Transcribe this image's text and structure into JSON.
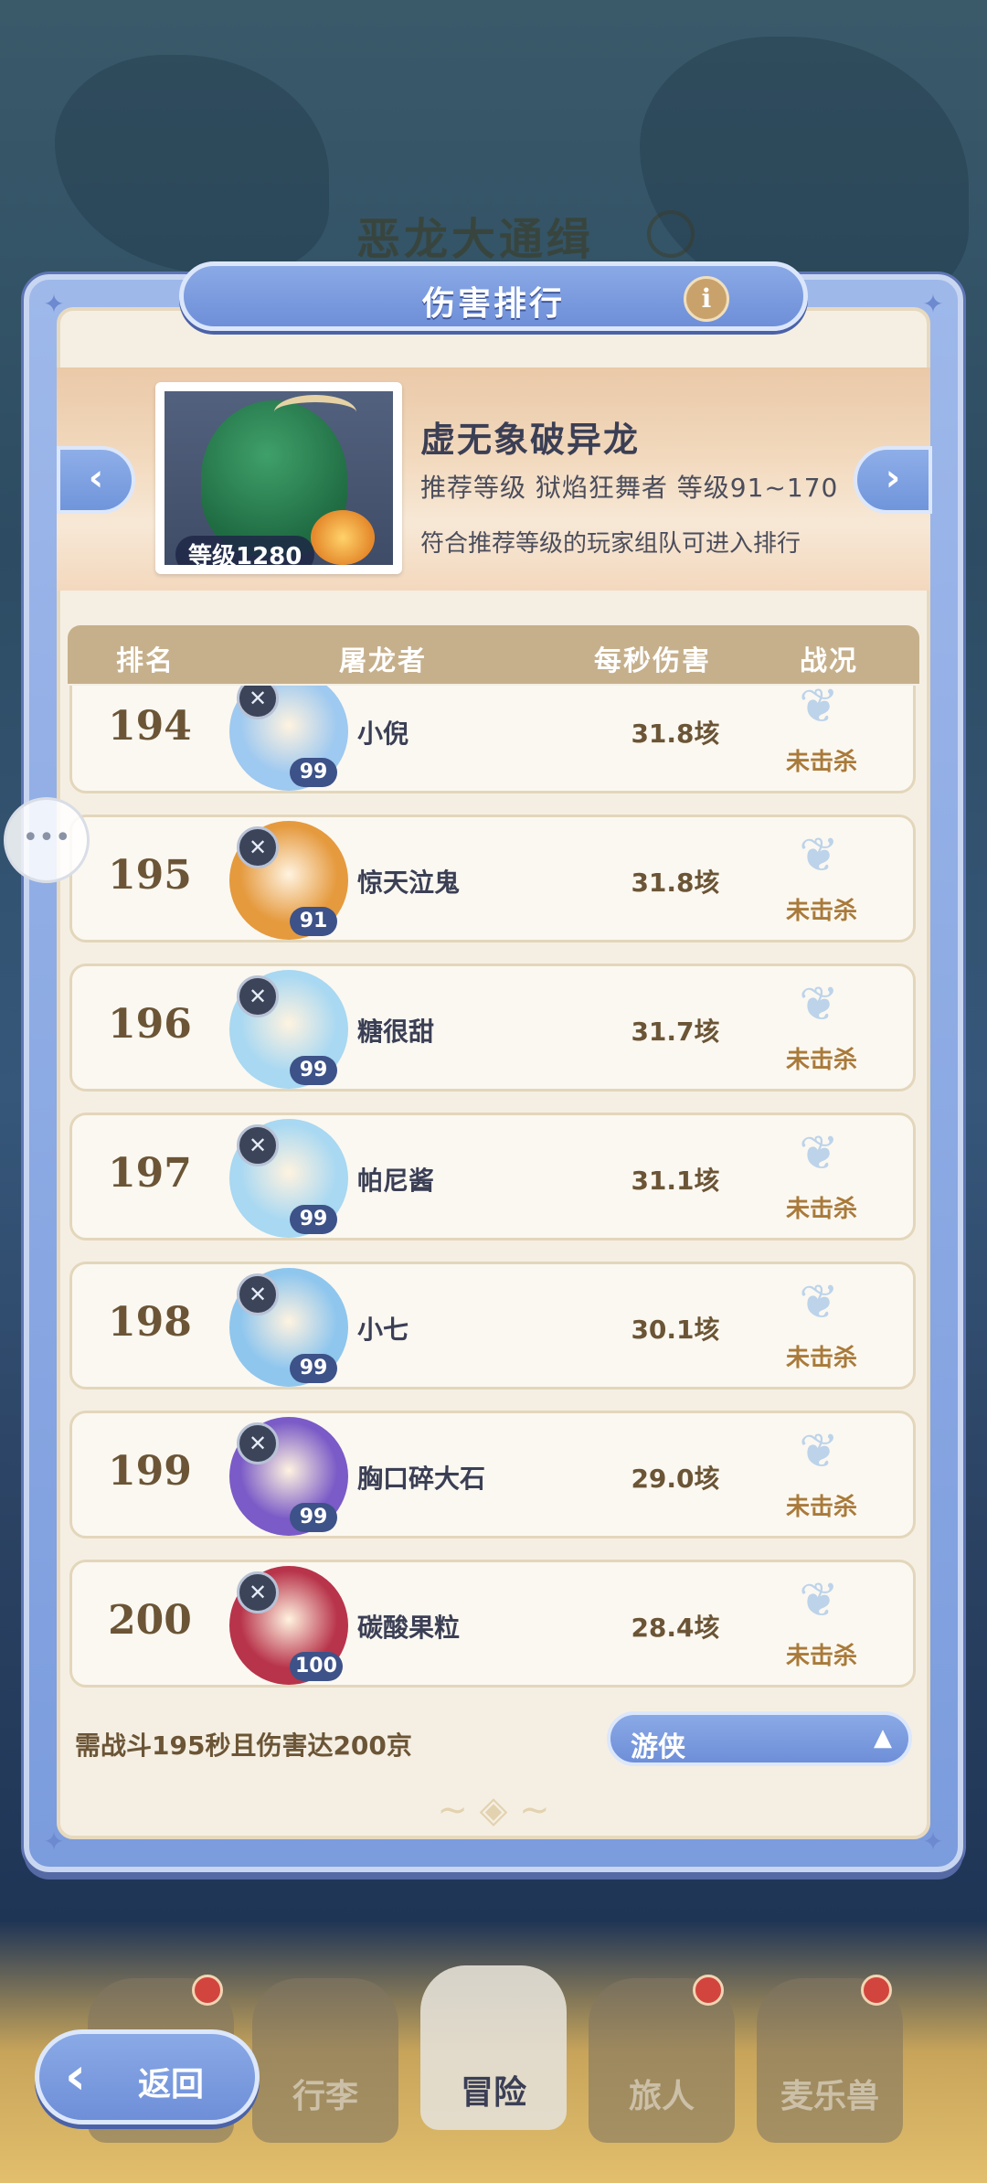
{
  "background": {
    "title": "恶龙大通缉"
  },
  "modal": {
    "title": "伤害排行",
    "info_icon": "i"
  },
  "boss": {
    "name": "虚无象破异龙",
    "level_badge": "等级1280",
    "recommendation": "推荐等级 狱焰狂舞者 等级91~170",
    "note": "符合推荐等级的玩家组队可进入排行"
  },
  "table": {
    "headers": {
      "rank": "排名",
      "player": "屠龙者",
      "dps": "每秒伤害",
      "status": "战况"
    },
    "rows": [
      {
        "rank": "194",
        "name": "小倪",
        "level": "99",
        "dps": "31.8垓",
        "status": "未击杀",
        "art_color": "#9ec9f0"
      },
      {
        "rank": "195",
        "name": "惊天泣鬼",
        "level": "91",
        "dps": "31.8垓",
        "status": "未击杀",
        "art_color": "#e59a3e"
      },
      {
        "rank": "196",
        "name": "糖很甜",
        "level": "99",
        "dps": "31.7垓",
        "status": "未击杀",
        "art_color": "#a8d8f2"
      },
      {
        "rank": "197",
        "name": "帕尼酱",
        "level": "99",
        "dps": "31.1垓",
        "status": "未击杀",
        "art_color": "#a8d8f2"
      },
      {
        "rank": "198",
        "name": "小七",
        "level": "99",
        "dps": "30.1垓",
        "status": "未击杀",
        "art_color": "#8ec6ee"
      },
      {
        "rank": "199",
        "name": "胸口碎大石",
        "level": "99",
        "dps": "29.0垓",
        "status": "未击杀",
        "art_color": "#7a5bc7"
      },
      {
        "rank": "200",
        "name": "碳酸果粒",
        "level": "100",
        "dps": "28.4垓",
        "status": "未击杀",
        "art_color": "#b8344a"
      }
    ]
  },
  "footer": {
    "requirement": "需战斗195秒且伤害达200京",
    "class_select": "游侠"
  },
  "nav": {
    "back": "返回",
    "tabs": [
      "行李",
      "冒险",
      "旅人",
      "麦乐兽"
    ]
  },
  "colors": {
    "accent": "#7095db",
    "panel": "#f5efe3",
    "header": "#c6b08c"
  }
}
